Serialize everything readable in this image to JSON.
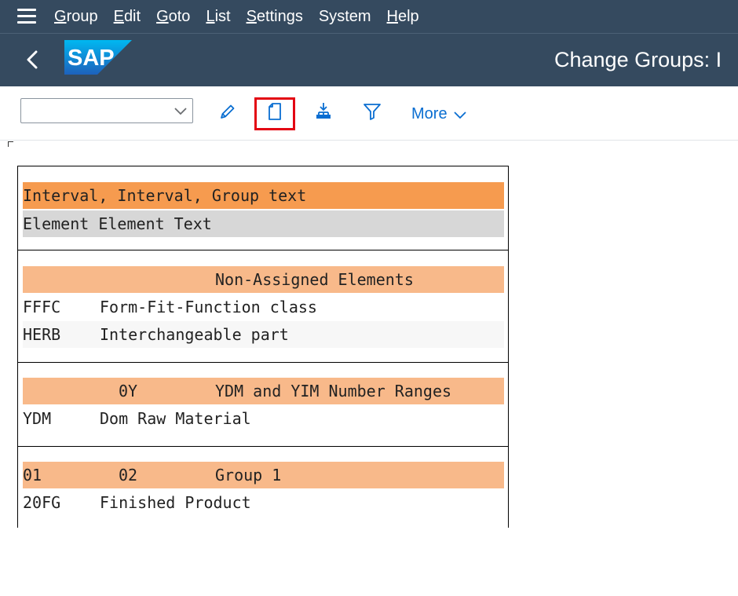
{
  "menubar": {
    "items": [
      {
        "first": "G",
        "rest": "roup"
      },
      {
        "first": "E",
        "rest": "dit"
      },
      {
        "first": "G",
        "rest": "oto"
      },
      {
        "first": "L",
        "rest": "ist"
      },
      {
        "first": "S",
        "rest": "ettings"
      },
      {
        "first": "Sy",
        "rest": "stem",
        "plain_first": true
      },
      {
        "first": "H",
        "rest": "elp"
      }
    ]
  },
  "shell": {
    "logo_text": "SAP",
    "title": "Change Groups: I"
  },
  "toolbar": {
    "select_value": "",
    "more_label": "More",
    "icons": [
      "edit-pencil-icon",
      "new-document-icon",
      "hierarchy-expand-icon",
      "filter-icon"
    ]
  },
  "colors": {
    "shell_bg": "#354a5f",
    "header_orange": "#f69b4f",
    "group_peach": "#f8b98a",
    "highlight_red": "#e30613",
    "link_blue": "#0a6ed1"
  },
  "list": {
    "header1": "Interval, Interval, Group text",
    "header2": "Element Element Text",
    "sections": [
      {
        "title_cols": [
          "",
          "",
          "Non-Assigned Elements"
        ],
        "rows": [
          [
            "FFFC",
            "Form-Fit-Function class"
          ],
          [
            "HERB",
            "Interchangeable part"
          ]
        ]
      },
      {
        "title_cols": [
          "",
          "0Y",
          "YDM and YIM Number Ranges"
        ],
        "rows": [
          [
            "YDM",
            "Dom Raw Material"
          ]
        ]
      },
      {
        "title_cols": [
          "01",
          "02",
          "Group 1"
        ],
        "rows": [
          [
            "20FG",
            "Finished Product"
          ]
        ]
      }
    ]
  }
}
